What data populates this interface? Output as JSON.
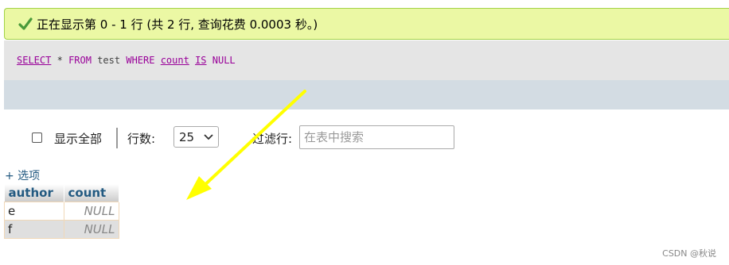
{
  "status": {
    "icon": "checkmark-icon",
    "message": "正在显示第 0 - 1 行 (共 2 行, 查询花费 0.0003 秒。)"
  },
  "sql": {
    "select": "SELECT",
    "star": "*",
    "from": "FROM",
    "table": "test",
    "where": "WHERE",
    "column": "count",
    "is": "IS",
    "null": "NULL"
  },
  "controls": {
    "show_all_label": "显示全部",
    "rows_label": "行数:",
    "rows_value": "25",
    "filter_label": "过滤行:",
    "filter_placeholder": "在表中搜索"
  },
  "options_link": "+ 选项",
  "table": {
    "headers": [
      "author",
      "count"
    ],
    "rows": [
      [
        "e",
        "NULL"
      ],
      [
        "f",
        "NULL"
      ]
    ]
  },
  "annotation": {
    "arrow_color": "#ffff00",
    "icon": "arrow-annotation"
  },
  "watermark": "CSDN @秋说"
}
